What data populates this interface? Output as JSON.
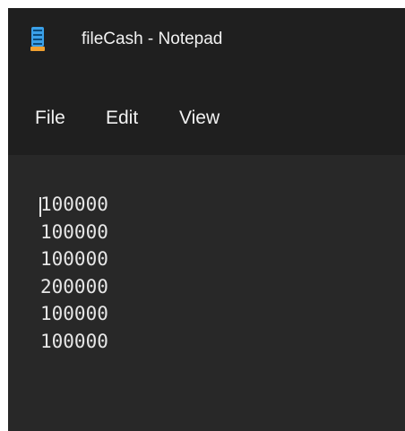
{
  "window": {
    "title": "fileCash - Notepad"
  },
  "menu": {
    "items": [
      {
        "label": "File"
      },
      {
        "label": "Edit"
      },
      {
        "label": "View"
      }
    ]
  },
  "editor": {
    "lines": [
      "100000",
      "100000",
      "100000",
      "200000",
      "100000",
      "100000"
    ]
  },
  "colors": {
    "background": "#202020",
    "editor_background": "#282828",
    "text": "#e6e6e6",
    "icon_accent": "#3aa0e8",
    "icon_base": "#f0a030"
  },
  "icons": {
    "app": "notepad-icon"
  }
}
